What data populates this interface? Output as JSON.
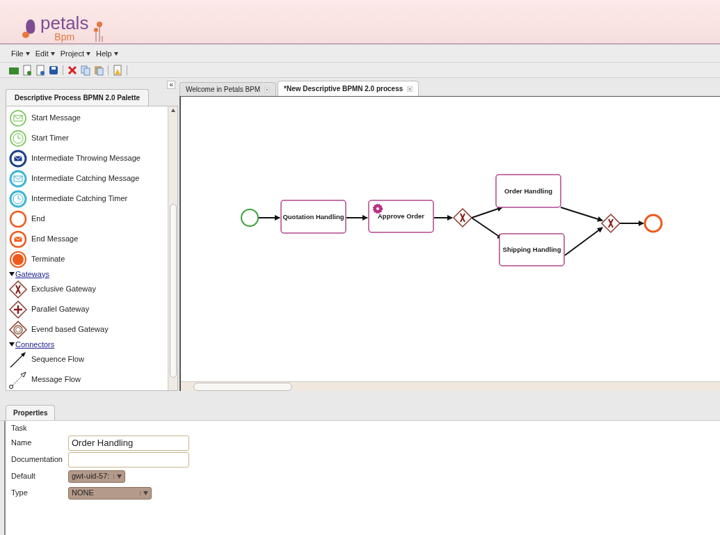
{
  "logo": {
    "name": "petals",
    "sub": "Bpm"
  },
  "menu": [
    {
      "label": "File"
    },
    {
      "label": "Edit"
    },
    {
      "label": "Project"
    },
    {
      "label": "Help"
    }
  ],
  "toolbar": [
    {
      "kind": "open"
    },
    {
      "kind": "new"
    },
    {
      "kind": "import"
    },
    {
      "kind": "save"
    },
    {
      "kind": "sep"
    },
    {
      "kind": "delete"
    },
    {
      "kind": "copy"
    },
    {
      "kind": "paste"
    },
    {
      "kind": "sep"
    },
    {
      "kind": "validate"
    },
    {
      "kind": "sep"
    }
  ],
  "palette": {
    "title": "Descriptive Process BPMN 2.0 Palette",
    "collapse": "«",
    "items": [
      {
        "kind": "start-message",
        "label": "Start Message"
      },
      {
        "kind": "start-timer",
        "label": "Start Timer"
      },
      {
        "kind": "throw-message",
        "label": "Intermediate Throwing Message"
      },
      {
        "kind": "catch-message",
        "label": "Intermediate Catching Message"
      },
      {
        "kind": "catch-timer",
        "label": "Intermediate Catching Timer"
      },
      {
        "kind": "end",
        "label": "End"
      },
      {
        "kind": "end-message",
        "label": "End Message"
      },
      {
        "kind": "terminate",
        "label": "Terminate"
      }
    ],
    "groups": [
      {
        "label": "Gateways",
        "expanded": true,
        "items": [
          {
            "kind": "exclusive",
            "label": "Exclusive Gateway"
          },
          {
            "kind": "parallel",
            "label": "Parallel Gateway"
          },
          {
            "kind": "event-based",
            "label": "Evend based Gateway"
          }
        ]
      },
      {
        "label": "Connectors",
        "expanded": true,
        "items": [
          {
            "kind": "sequence",
            "label": "Sequence Flow"
          },
          {
            "kind": "message",
            "label": "Message Flow"
          }
        ]
      }
    ]
  },
  "tabs": [
    {
      "label": "Welcome in Petals BPM",
      "selected": false
    },
    {
      "label": "*New Descriptive BPMN 2.0 process",
      "selected": true
    }
  ],
  "diagram": {
    "nodes": [
      {
        "kind": "start"
      },
      {
        "kind": "task",
        "label": "Quotation Handling"
      },
      {
        "kind": "service-task",
        "label": "Approve Order"
      },
      {
        "kind": "gateway"
      },
      {
        "kind": "task",
        "label": "Order Handling"
      },
      {
        "kind": "task",
        "label": "Shipping Handling"
      },
      {
        "kind": "gateway"
      },
      {
        "kind": "end"
      }
    ]
  },
  "properties": {
    "tab": "Properties",
    "section": "Task",
    "fields": [
      {
        "kind": "text",
        "label": "Name",
        "value": "Order Handling"
      },
      {
        "kind": "text",
        "label": "Documentation"
      },
      {
        "kind": "select",
        "label": "Default",
        "value": "gwt-uid-57:"
      },
      {
        "kind": "select",
        "label": "Type",
        "value": "NONE"
      }
    ]
  }
}
